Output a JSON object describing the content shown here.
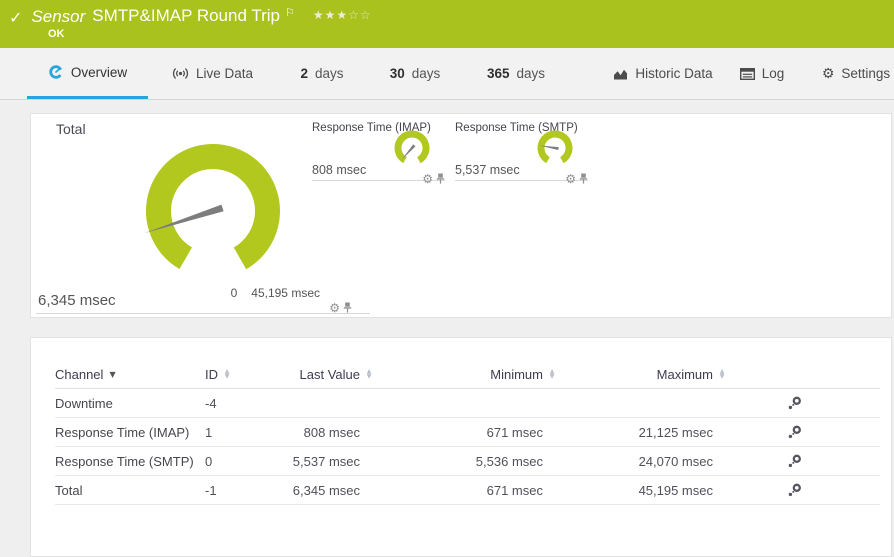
{
  "colors": {
    "header_green": "#a9c21d",
    "gauge_green": "#b2c81e",
    "accent_blue": "#2aa4dc",
    "needle_gray": "#7d7d7d",
    "page_bg": "#efeff0",
    "tabbar_bg": "#f2f2f2",
    "panel_bg": "#ffffff"
  },
  "icons": {
    "check": "✓",
    "flag": "⚐",
    "gear": "⚙",
    "stars_filled": "★★★",
    "stars_empty": "☆☆",
    "sort_asc": "▲",
    "sort_desc": "▼",
    "sorted": "▼"
  },
  "header": {
    "kind": "Sensor",
    "title": "SMTP&IMAP Round Trip",
    "status": "OK",
    "priority_filled": 3,
    "priority_total": 5
  },
  "tabs": {
    "overview": "Overview",
    "live_data": "Live Data",
    "d2_num": "2",
    "d2_label": "days",
    "d30_num": "30",
    "d30_label": "days",
    "d365_num": "365",
    "d365_label": "days",
    "historic": "Historic Data",
    "log": "Log",
    "settings": "Settings"
  },
  "gauges": {
    "total": {
      "label": "Total",
      "value": 6345,
      "min": 0,
      "max": 45195,
      "unit": "msec",
      "value_label": "6,345 msec",
      "min_label": "0",
      "max_label": "45,195 msec"
    },
    "imap": {
      "label": "Response Time (IMAP)",
      "value": 808,
      "min": 0,
      "max": 21125,
      "unit": "msec",
      "value_label": "808 msec"
    },
    "smtp": {
      "label": "Response Time (SMTP)",
      "value": 5537,
      "min": 0,
      "max": 24070,
      "unit": "msec",
      "value_label": "5,537 msec"
    }
  },
  "table": {
    "headers": {
      "channel": "Channel",
      "id": "ID",
      "last_value": "Last Value",
      "minimum": "Minimum",
      "maximum": "Maximum"
    },
    "rows": [
      {
        "channel": "Downtime",
        "id": "-4",
        "last": "",
        "min": "",
        "max": ""
      },
      {
        "channel": "Response Time (IMAP)",
        "id": "1",
        "last": "808 msec",
        "min": "671 msec",
        "max": "21,125 msec"
      },
      {
        "channel": "Response Time (SMTP)",
        "id": "0",
        "last": "5,537 msec",
        "min": "5,536 msec",
        "max": "24,070 msec"
      },
      {
        "channel": "Total",
        "id": "-1",
        "last": "6,345 msec",
        "min": "671 msec",
        "max": "45,195 msec"
      }
    ]
  }
}
